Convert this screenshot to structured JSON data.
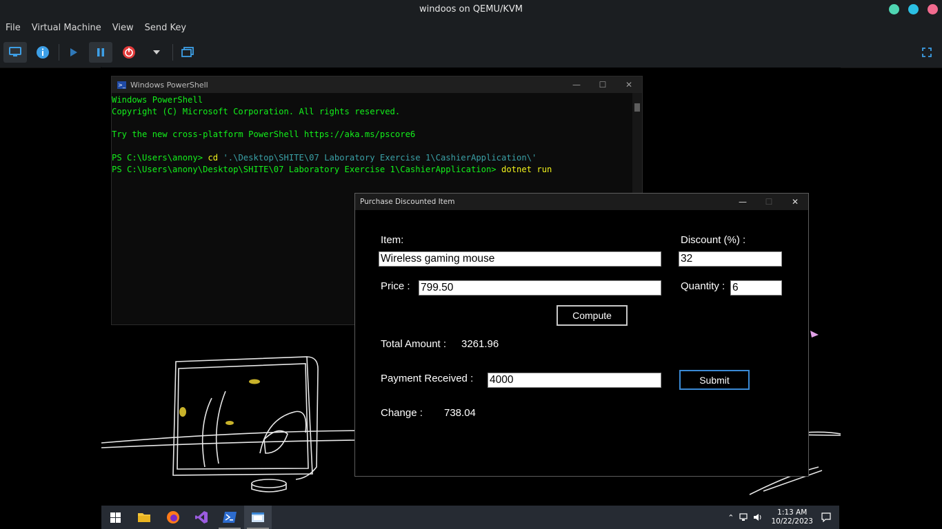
{
  "window": {
    "title": "windoos on QEMU/KVM",
    "controls": {
      "colors": [
        "#4fd6b3",
        "#2bc0e4",
        "#f26b8f"
      ]
    }
  },
  "menubar": {
    "items": [
      "File",
      "Virtual Machine",
      "View",
      "Send Key"
    ]
  },
  "toolbar": {
    "buttons": [
      {
        "icon": "monitor-icon",
        "active": true
      },
      {
        "icon": "info-icon"
      },
      {
        "icon": "play-icon"
      },
      {
        "icon": "pause-icon",
        "active": true
      },
      {
        "icon": "power-icon"
      },
      {
        "icon": "chevron-down-icon"
      },
      {
        "icon": "snapshots-icon"
      },
      {
        "icon": "fullscreen-icon"
      }
    ]
  },
  "powershell": {
    "title": "Windows PowerShell",
    "lines": [
      "Windows PowerShell",
      "Copyright (C) Microsoft Corporation. All rights reserved.",
      "",
      "Try the new cross-platform PowerShell https://aka.ms/pscore6",
      ""
    ],
    "prompt1": "PS C:\\Users\\anony> ",
    "cmd1": "cd",
    "arg1": " '.\\Desktop\\SHITE\\07 Laboratory Exercise 1\\CashierApplication\\'",
    "prompt2": "PS C:\\Users\\anony\\Desktop\\SHITE\\07 Laboratory Exercise 1\\CashierApplication> ",
    "cmd2": "dotnet",
    "arg2": " run"
  },
  "dialog": {
    "title": "Purchase Discounted Item",
    "item_label": "Item:",
    "item_value": "Wireless gaming mouse",
    "discount_label": "Discount (%) :",
    "discount_value": "32",
    "price_label": "Price :",
    "price_value": "799.50",
    "quantity_label": "Quantity :",
    "quantity_value": "6",
    "compute_label": "Compute",
    "total_label": "Total Amount :",
    "total_value": "3261.96",
    "payment_label": "Payment Received :",
    "payment_value": "4000",
    "submit_label": "Submit",
    "change_label": "Change :",
    "change_value": "738.04"
  },
  "taskbar": {
    "apps": [
      "start-icon",
      "file-explorer-icon",
      "firefox-icon",
      "visual-studio-icon",
      "powershell-icon",
      "cashier-app-icon"
    ],
    "time": "1:13 AM",
    "date": "10/22/2023"
  }
}
